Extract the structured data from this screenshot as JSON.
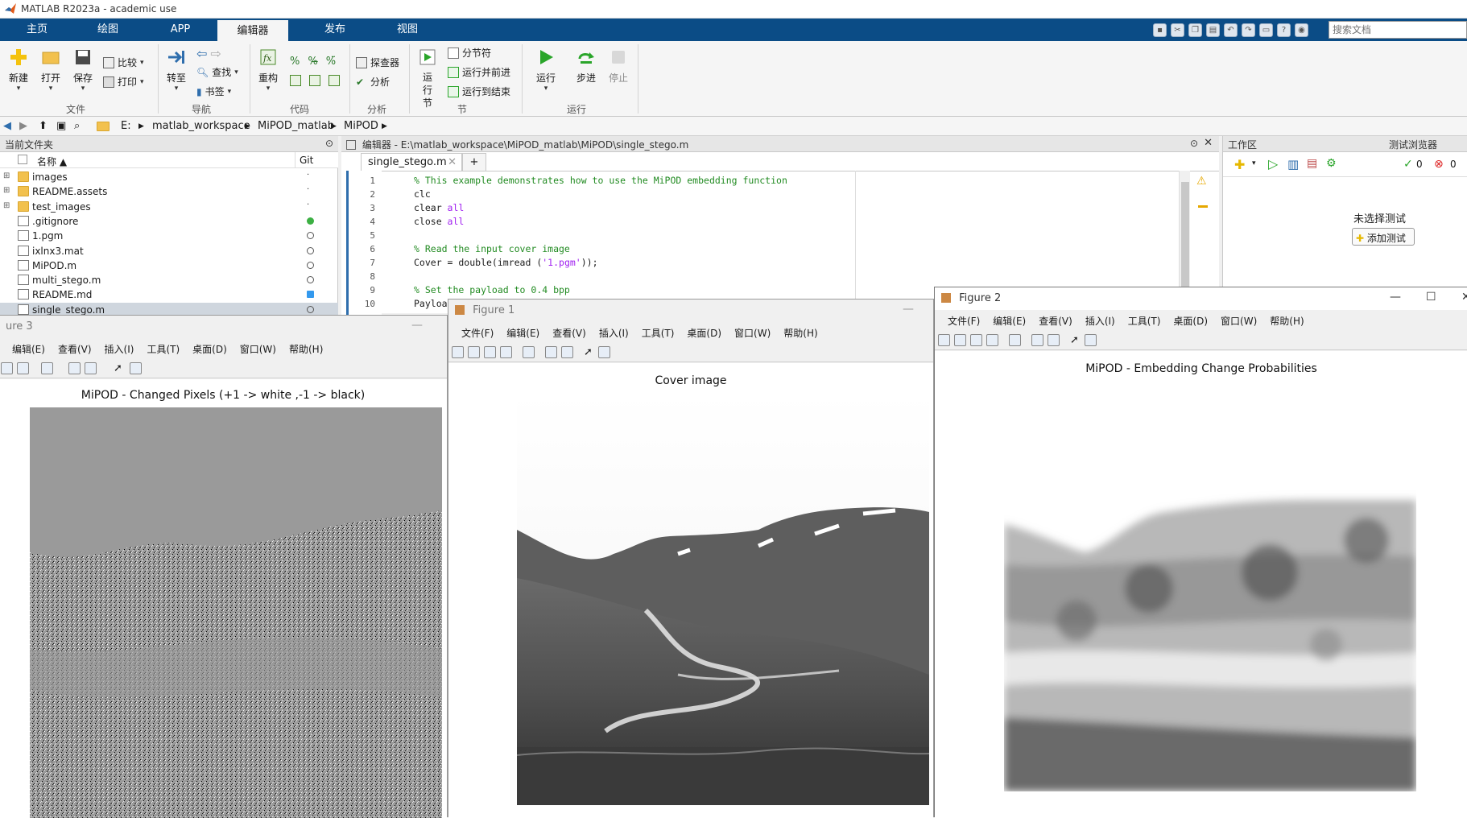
{
  "app": {
    "title": "MATLAB R2023a - academic use"
  },
  "tabs": [
    "主页",
    "绘图",
    "APP",
    "编辑器",
    "发布",
    "视图"
  ],
  "search_docs": {
    "placeholder": "搜索文档"
  },
  "ribbon": {
    "file": {
      "new": "新建",
      "open": "打开",
      "save": "保存",
      "compare": "比较",
      "print": "打印",
      "group": "文件"
    },
    "nav": {
      "goto": "转至",
      "find": "查找",
      "bookmark": "书签",
      "group": "导航"
    },
    "code": {
      "refactor": "重构",
      "group": "代码"
    },
    "analyze": {
      "explorer": "探查器",
      "analyze": "分析",
      "group": "分析"
    },
    "section": {
      "run_section": "运行节",
      "section_break": "分节符",
      "run_advance": "运行并前进",
      "run_to_end": "运行到结束",
      "group": "节"
    },
    "run": {
      "run": "运行",
      "step": "步进",
      "stop": "停止",
      "group": "运行"
    }
  },
  "address": {
    "crumbs": [
      "E:",
      "matlab_workspace",
      "MiPOD_matlab",
      "MiPOD"
    ]
  },
  "folder": {
    "title": "当前文件夹",
    "col_name": "名称 ▲",
    "col_git": "Git",
    "rows": [
      {
        "name": "images",
        "type": "folder",
        "git": "·"
      },
      {
        "name": "README.assets",
        "type": "folder",
        "git": "·"
      },
      {
        "name": "test_images",
        "type": "folder",
        "git": "·"
      },
      {
        "name": ".gitignore",
        "type": "file",
        "git": "green"
      },
      {
        "name": "1.pgm",
        "type": "file",
        "git": "circle"
      },
      {
        "name": "ixlnx3.mat",
        "type": "file",
        "git": "circle"
      },
      {
        "name": "MiPOD.m",
        "type": "file",
        "git": "circle"
      },
      {
        "name": "multi_stego.m",
        "type": "file",
        "git": "circle"
      },
      {
        "name": "README.md",
        "type": "file",
        "git": "blue"
      },
      {
        "name": "single_stego.m",
        "type": "file",
        "git": "circle"
      }
    ]
  },
  "editor": {
    "title": "编辑器 - E:\\matlab_workspace\\MiPOD_matlab\\MiPOD\\single_stego.m",
    "tab": "single_stego.m",
    "add_tab": "+",
    "line_numbers": [
      "1",
      "2",
      "3",
      "4",
      "5",
      "6",
      "7",
      "8",
      "9",
      "10"
    ],
    "lines": [
      {
        "kind": "comment",
        "text": "% This example demonstrates how to use the MiPOD embedding function"
      },
      {
        "kind": "code",
        "text": "clc"
      },
      {
        "kind": "kw",
        "pre": "clear ",
        "kw": "all"
      },
      {
        "kind": "kw",
        "pre": "close ",
        "kw": "all"
      },
      {
        "kind": "code",
        "text": ""
      },
      {
        "kind": "comment",
        "text": "% Read the input cover image"
      },
      {
        "kind": "str",
        "pre": "Cover = double(imread (",
        "str": "'1.pgm'",
        "post": "));"
      },
      {
        "kind": "code",
        "text": ""
      },
      {
        "kind": "comment",
        "text": "% Set the payload to 0.4 bpp"
      },
      {
        "kind": "code",
        "text": "Payloa"
      }
    ]
  },
  "right_panel": {
    "workspace": "工作区",
    "test_browser": "测试浏览器",
    "pass_count": "0",
    "fail_count": "0",
    "no_test": "未选择测试",
    "add_test": "添加测试"
  },
  "figures": {
    "menu_full": [
      "文件(F)",
      "编辑(E)",
      "查看(V)",
      "插入(I)",
      "工具(T)",
      "桌面(D)",
      "窗口(W)",
      "帮助(H)"
    ],
    "menu_cut": [
      "编辑(E)",
      "查看(V)",
      "插入(I)",
      "工具(T)",
      "桌面(D)",
      "窗口(W)",
      "帮助(H)"
    ],
    "fig3": {
      "title": "ure 3",
      "axes_title": "MiPOD - Changed Pixels (+1 -> white ,-1 -> black)"
    },
    "fig1": {
      "title": "Figure 1",
      "axes_title": "Cover image"
    },
    "fig2": {
      "title": "Figure 2",
      "axes_title": "MiPOD - Embedding Change Probabilities"
    }
  }
}
